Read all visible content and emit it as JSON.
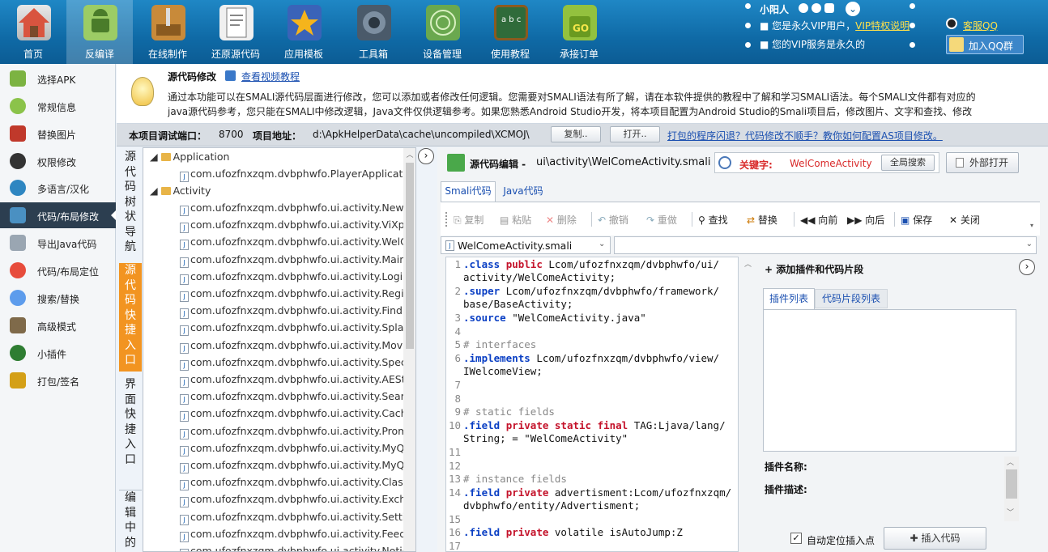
{
  "toolbar": {
    "items": [
      {
        "label": "首页",
        "icon": "house-icon",
        "color": "#d9543f"
      },
      {
        "label": "反编译",
        "icon": "android-icon",
        "color": "#8bc34a"
      },
      {
        "label": "在线制作",
        "icon": "tools-icon",
        "color": "#c88a3a"
      },
      {
        "label": "还原源代码",
        "icon": "document-icon",
        "color": "#e8e8e8"
      },
      {
        "label": "应用模板",
        "icon": "star-icon",
        "color": "#3a63b8"
      },
      {
        "label": "工具箱",
        "icon": "gear-icon",
        "color": "#5a6b7d"
      },
      {
        "label": "设备管理",
        "icon": "device-icon",
        "color": "#6aa84f"
      },
      {
        "label": "使用教程",
        "icon": "blackboard-icon",
        "color": "#2f6b3a"
      },
      {
        "label": "承接订单",
        "icon": "shopping-bag-icon",
        "color": "#93c13e"
      }
    ],
    "active_index": 1
  },
  "user": {
    "name": "小阳人",
    "vip_text": "您是永久VIP用户，",
    "vip_link": "VIP特权说明",
    "vip_forever": "您的VIP服务是永久的",
    "service_qq": "客服QQ",
    "join_group": "加入QQ群"
  },
  "sidebar": {
    "items": [
      {
        "label": "选择APK",
        "icon": "android-icon",
        "color": "#7cb342"
      },
      {
        "label": "常规信息",
        "icon": "gear-icon",
        "color": "#8bc34a"
      },
      {
        "label": "替换图片",
        "icon": "image-icon",
        "color": "#c0392b"
      },
      {
        "label": "权限修改",
        "icon": "lock-icon",
        "color": "#333333"
      },
      {
        "label": "多语言/汉化",
        "icon": "globe-icon",
        "color": "#2e86c1"
      },
      {
        "label": "代码/布局修改",
        "icon": "terminal-icon",
        "color": "#4a90c2"
      },
      {
        "label": "导出Java代码",
        "icon": "export-icon",
        "color": "#9aa6b2"
      },
      {
        "label": "代码/布局定位",
        "icon": "location-icon",
        "color": "#e74c3c"
      },
      {
        "label": "搜索/替换",
        "icon": "search-icon",
        "color": "#5d9cec"
      },
      {
        "label": "高级模式",
        "icon": "wrench-icon",
        "color": "#7f6a4a"
      },
      {
        "label": "小插件",
        "icon": "android-icon",
        "color": "#2e7d32"
      },
      {
        "label": "打包/签名",
        "icon": "package-icon",
        "color": "#d4a017"
      }
    ],
    "active_index": 5
  },
  "info": {
    "title": "源代码修改",
    "video_link": "查看视频教程",
    "line1": "通过本功能可以在SMALI源代码层面进行修改，您可以添加或者修改任何逻辑。您需要对SMALI语法有所了解，请在本软件提供的教程中了解和学习SMALI语法。每个SMALI文件都有对应的",
    "line2": "java源代码参考，您只能在SMALI中修改逻辑，Java文件仅供逻辑参考。如果您熟悉Android Studio开发，将本项目配置为Android Studio的Smali项目后，修改图片、文字和查找、修改"
  },
  "portbar": {
    "port_label": "本项目调试端口：",
    "port": "8700",
    "addr_label": "项目地址：",
    "addr": "d:\\ApkHelperData\\cache\\uncompiled\\XCMOJ\\",
    "copy": "复制..",
    "open": "打开..",
    "help_link": "打包的程序闪退？代码修改不顺手？教你如何配置AS项目修改。"
  },
  "vertical_tabs": {
    "tree_nav": [
      "源",
      "代",
      "码",
      "树",
      "状",
      "导",
      "航"
    ],
    "quick_source": [
      "源",
      "代",
      "码",
      "快",
      "捷",
      "入",
      "口"
    ],
    "quick_ui": [
      "界",
      "面",
      "快",
      "捷",
      "入",
      "口"
    ],
    "editing": [
      "编",
      "辑",
      "中",
      "的"
    ]
  },
  "tree": {
    "groups": [
      "Application",
      "Activity"
    ],
    "app_items": [
      "com.ufozfnxzqm.dvbphwfo.PlayerApplicati"
    ],
    "activity_items": [
      "com.ufozfnxzqm.dvbphwfo.ui.activity.NewI",
      "com.ufozfnxzqm.dvbphwfo.ui.activity.ViXpl",
      "com.ufozfnxzqm.dvbphwfo.ui.activity.WelC",
      "com.ufozfnxzqm.dvbphwfo.ui.activity.Main",
      "com.ufozfnxzqm.dvbphwfo.ui.activity.Login",
      "com.ufozfnxzqm.dvbphwfo.ui.activity.Regis",
      "com.ufozfnxzqm.dvbphwfo.ui.activity.FindF",
      "com.ufozfnxzqm.dvbphwfo.ui.activity.Splas",
      "com.ufozfnxzqm.dvbphwfo.ui.activity.Movi",
      "com.ufozfnxzqm.dvbphwfo.ui.activity.Spec",
      "com.ufozfnxzqm.dvbphwfo.ui.activity.AESt",
      "com.ufozfnxzqm.dvbphwfo.ui.activity.Searc",
      "com.ufozfnxzqm.dvbphwfo.ui.activity.Cach",
      "com.ufozfnxzqm.dvbphwfo.ui.activity.Prom",
      "com.ufozfnxzqm.dvbphwfo.ui.activity.MyQ",
      "com.ufozfnxzqm.dvbphwfo.ui.activity.MyQ",
      "com.ufozfnxzqm.dvbphwfo.ui.activity.Class",
      "com.ufozfnxzqm.dvbphwfo.ui.activity.Excha",
      "com.ufozfnxzqm.dvbphwfo.ui.activity.Setti",
      "com.ufozfnxzqm.dvbphwfo.ui.activity.Feed",
      "com.ufozfnxzqm.dvbphwfo.ui.activity.Notic"
    ]
  },
  "editor": {
    "title": "源代码编辑 -",
    "path": "ui\\activity\\WelComeActivity.smali",
    "keyword_label": "关键字:",
    "keyword": "WelComeActivity",
    "global_search": "全局搜索",
    "open_external": "外部打开",
    "tabs": [
      "Smali代码",
      "Java代码"
    ],
    "tools": [
      "复制",
      "粘贴",
      "删除",
      "撤销",
      "重做",
      "查找",
      "替换",
      "向前",
      "向后",
      "保存",
      "关闭"
    ],
    "file_select": "WelComeActivity.smali"
  },
  "code": {
    "line_numbers": [
      "1",
      "",
      "2",
      "",
      "3",
      "4",
      "5",
      "6",
      "",
      "7",
      "8",
      "9",
      "10",
      "",
      "11",
      "12",
      "13",
      "14",
      "",
      "15",
      "16",
      "17"
    ]
  },
  "plugin": {
    "header": "添加插件和代码片段",
    "tabs": [
      "插件列表",
      "代码片段列表"
    ],
    "name_label": "插件名称:",
    "desc_label": "插件描述:",
    "auto_locate": "自动定位插入点",
    "insert_code": "插入代码"
  }
}
